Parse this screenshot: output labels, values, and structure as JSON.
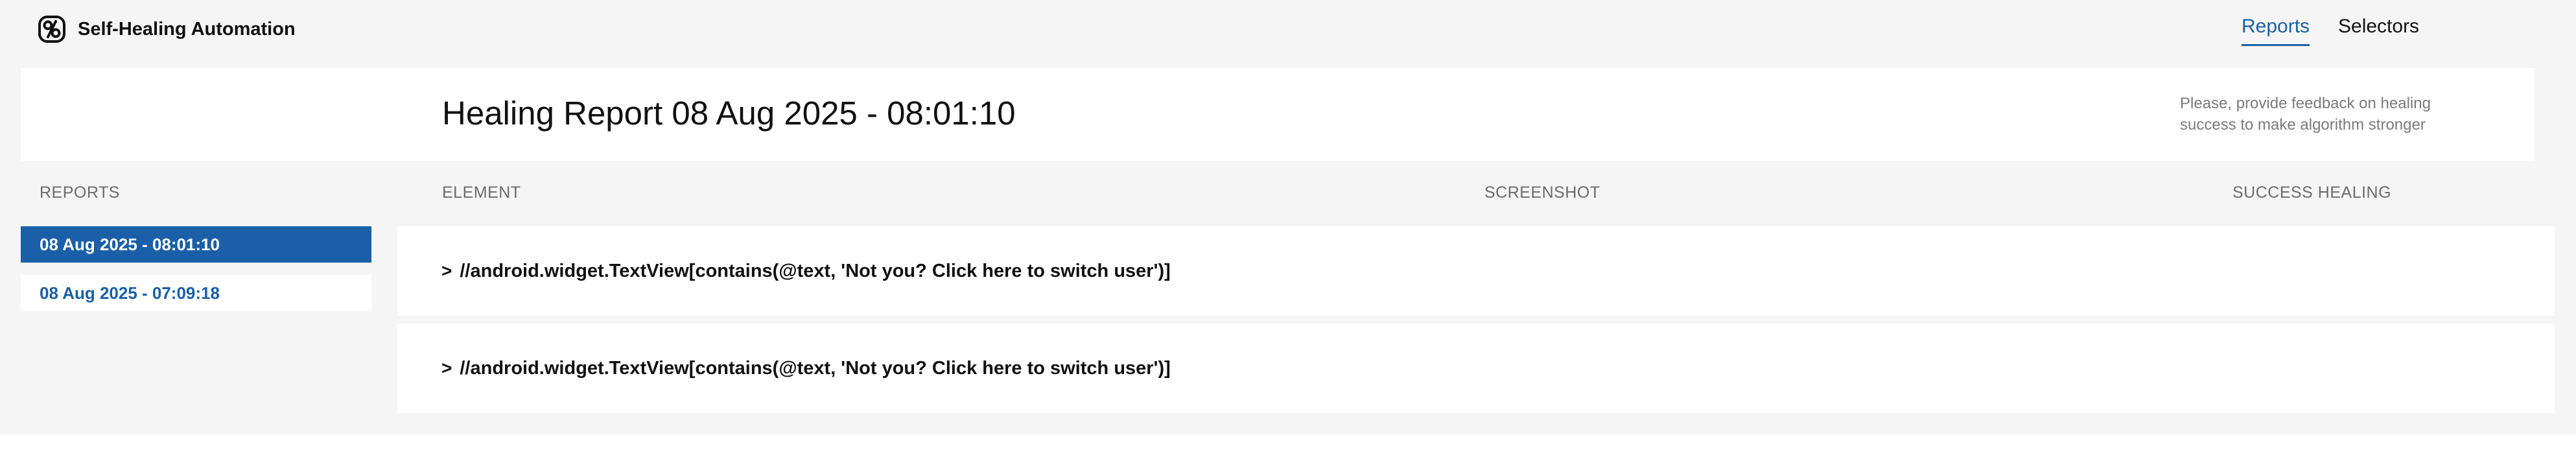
{
  "app": {
    "title": "Self-Healing Automation",
    "logo_icon": "self-healing-logo-icon",
    "accent_color": "#1a5fa8"
  },
  "nav": {
    "items": [
      {
        "label": "Reports",
        "active": true
      },
      {
        "label": "Selectors",
        "active": false
      }
    ]
  },
  "report": {
    "title": "Healing Report 08 Aug 2025 - 08:01:10",
    "feedback_note": "Please, provide feedback on healing success to make algorithm stronger"
  },
  "sidebar": {
    "header": "REPORTS",
    "items": [
      {
        "label": "08 Aug 2025 - 08:01:10",
        "selected": true
      },
      {
        "label": "08 Aug 2025 - 07:09:18",
        "selected": false
      }
    ]
  },
  "table": {
    "columns": [
      "ELEMENT",
      "SCREENSHOT",
      "SUCCESS HEALING"
    ],
    "rows": [
      {
        "chevron_icon": "chevron-right-icon",
        "chevron": ">",
        "element": "//android.widget.TextView[contains(@text, 'Not you? Click here to switch user')]"
      },
      {
        "chevron_icon": "chevron-right-icon",
        "chevron": ">",
        "element": "//android.widget.TextView[contains(@text, 'Not you? Click here to switch user')]"
      }
    ]
  }
}
